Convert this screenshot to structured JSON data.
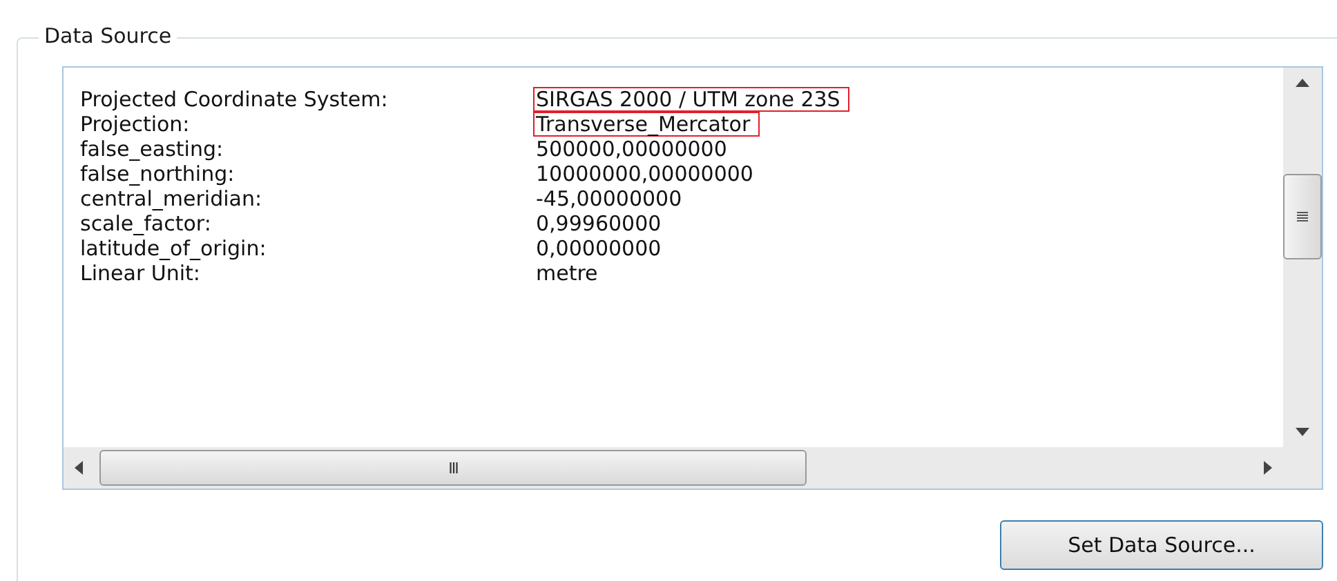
{
  "group": {
    "title": "Data Source"
  },
  "properties": [
    {
      "label": "Projected Coordinate System:",
      "value": "SIRGAS 2000 / UTM zone 23S",
      "highlighted": true
    },
    {
      "label": "Projection:",
      "value": "Transverse_Mercator",
      "highlighted": true
    },
    {
      "label": "false_easting:",
      "value": "500000,00000000",
      "highlighted": false
    },
    {
      "label": "false_northing:",
      "value": "10000000,00000000",
      "highlighted": false
    },
    {
      "label": "central_meridian:",
      "value": "-45,00000000",
      "highlighted": false
    },
    {
      "label": "scale_factor:",
      "value": "0,99960000",
      "highlighted": false
    },
    {
      "label": "latitude_of_origin:",
      "value": "0,00000000",
      "highlighted": false
    },
    {
      "label": "Linear Unit:",
      "value": "metre",
      "highlighted": false
    }
  ],
  "horizontal_scrollbar": {
    "grip": "III"
  },
  "button": {
    "label": "Set Data Source..."
  }
}
